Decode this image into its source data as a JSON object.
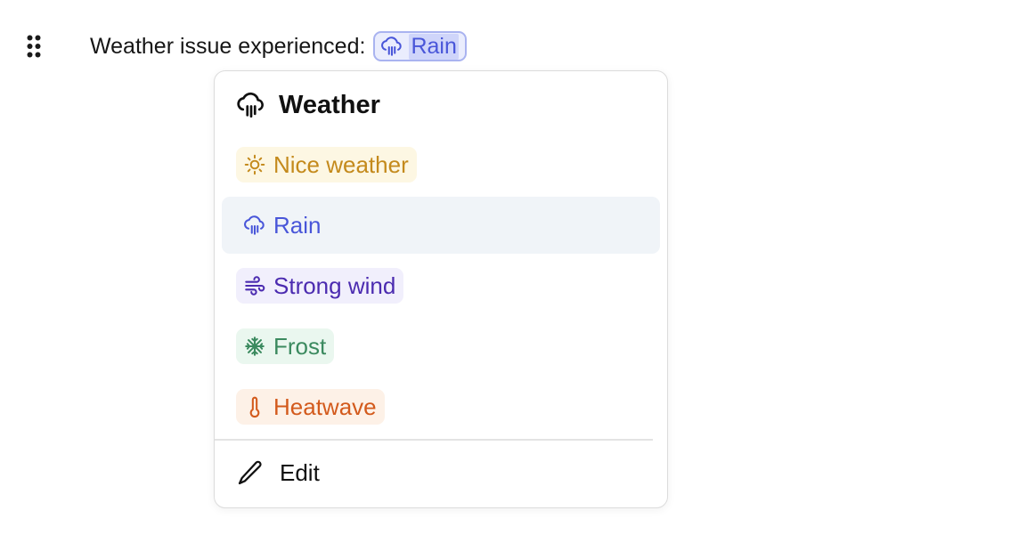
{
  "line": {
    "label": "Weather issue experienced:",
    "selected": {
      "label": "Rain",
      "icon": "cloud-rain-icon",
      "color": "#4956d9",
      "bg": "#eaedfd"
    }
  },
  "popover": {
    "header": {
      "icon": "cloud-rain-icon",
      "title": "Weather"
    },
    "options": [
      {
        "label": "Nice weather",
        "icon": "sun-icon",
        "color": "#c48a1c",
        "bg": "#fdf7e3",
        "highlighted": false
      },
      {
        "label": "Rain",
        "icon": "cloud-rain-icon",
        "color": "#4956d9",
        "bg": "#f0f4f8",
        "highlighted": true
      },
      {
        "label": "Strong wind",
        "icon": "wind-icon",
        "color": "#4b2bb0",
        "bg": "#f1effc",
        "highlighted": false
      },
      {
        "label": "Frost",
        "icon": "snowflake-icon",
        "color": "#3b8a5f",
        "bg": "#eaf7ef",
        "highlighted": false
      },
      {
        "label": "Heatwave",
        "icon": "thermometer-icon",
        "color": "#d35a1c",
        "bg": "#fdf1e7",
        "highlighted": false
      }
    ],
    "edit": {
      "label": "Edit",
      "icon": "pencil-icon"
    }
  }
}
